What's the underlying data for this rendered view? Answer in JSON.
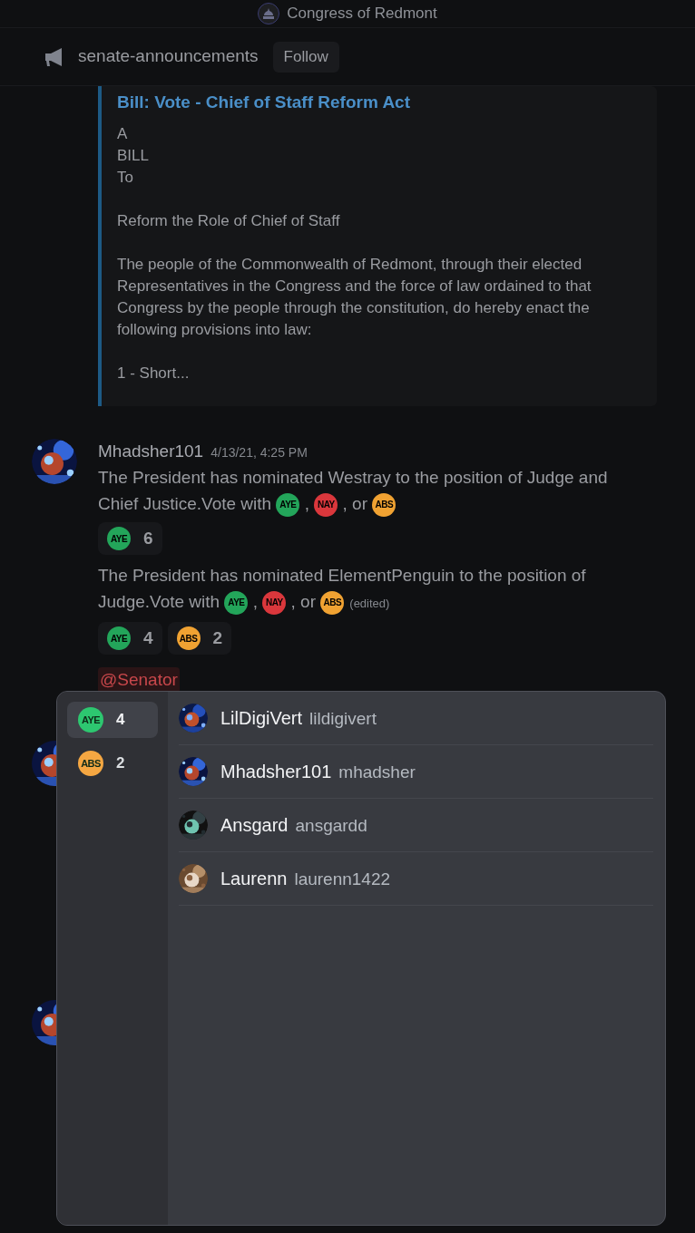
{
  "server": {
    "name": "Congress of Redmont"
  },
  "channel": {
    "name": "senate-announcements",
    "follow_button": "Follow"
  },
  "embed": {
    "title": "Bill: Vote - Chief of Staff Reform Act",
    "paragraphs": [
      [
        "A",
        "BILL",
        "To"
      ],
      [
        "Reform the Role of Chief of Staff"
      ],
      [
        "The people of the Commonwealth of Redmont, through their elected Representatives in the Congress and the force of law ordained to that Congress by the people through the constitution, do hereby enact the following provisions into law:"
      ],
      [
        "1 - Short..."
      ]
    ]
  },
  "message": {
    "author": "Mhadsher101",
    "timestamp": "4/13/21, 4:25 PM",
    "posts": [
      {
        "parts": [
          {
            "kind": "text",
            "text": "The President has nominated Westray to the position of Judge and Chief Justice.Vote with "
          },
          {
            "kind": "emoji",
            "color": "#23a55a",
            "label": "AYE"
          },
          {
            "kind": "text",
            "text": " , "
          },
          {
            "kind": "emoji",
            "color": "#da373c",
            "label": "NAY"
          },
          {
            "kind": "text",
            "text": " , or "
          },
          {
            "kind": "emoji",
            "color": "#f0a232",
            "label": "ABS"
          }
        ],
        "reactions": [
          {
            "color": "#23a55a",
            "label": "AYE",
            "count": "6"
          }
        ]
      },
      {
        "parts": [
          {
            "kind": "text",
            "text": "The President has nominated ElementPenguin to the position of Judge.Vote with "
          },
          {
            "kind": "emoji",
            "color": "#23a55a",
            "label": "AYE"
          },
          {
            "kind": "text",
            "text": " , "
          },
          {
            "kind": "emoji",
            "color": "#da373c",
            "label": "NAY"
          },
          {
            "kind": "text",
            "text": " , or "
          },
          {
            "kind": "emoji",
            "color": "#f0a232",
            "label": "ABS"
          },
          {
            "kind": "edited",
            "text": "(edited)"
          }
        ],
        "reactions": [
          {
            "color": "#23a55a",
            "label": "AYE",
            "count": "4"
          },
          {
            "color": "#f0a232",
            "label": "ABS",
            "count": "2"
          }
        ]
      }
    ],
    "mention": "@Senator"
  },
  "reactions_popup": {
    "tabs": [
      {
        "color": "#2dc770",
        "label": "AYE",
        "count": "4",
        "selected": true
      },
      {
        "color": "#f5a742",
        "label": "ABS",
        "count": "2",
        "selected": false
      }
    ],
    "users": [
      {
        "display_name": "LilDigiVert",
        "username": "lildigivert"
      },
      {
        "display_name": "Mhadsher101",
        "username": "mhadsher"
      },
      {
        "display_name": "Ansgard",
        "username": "ansgardd"
      },
      {
        "display_name": "Laurenn",
        "username": "laurenn1422"
      }
    ]
  }
}
